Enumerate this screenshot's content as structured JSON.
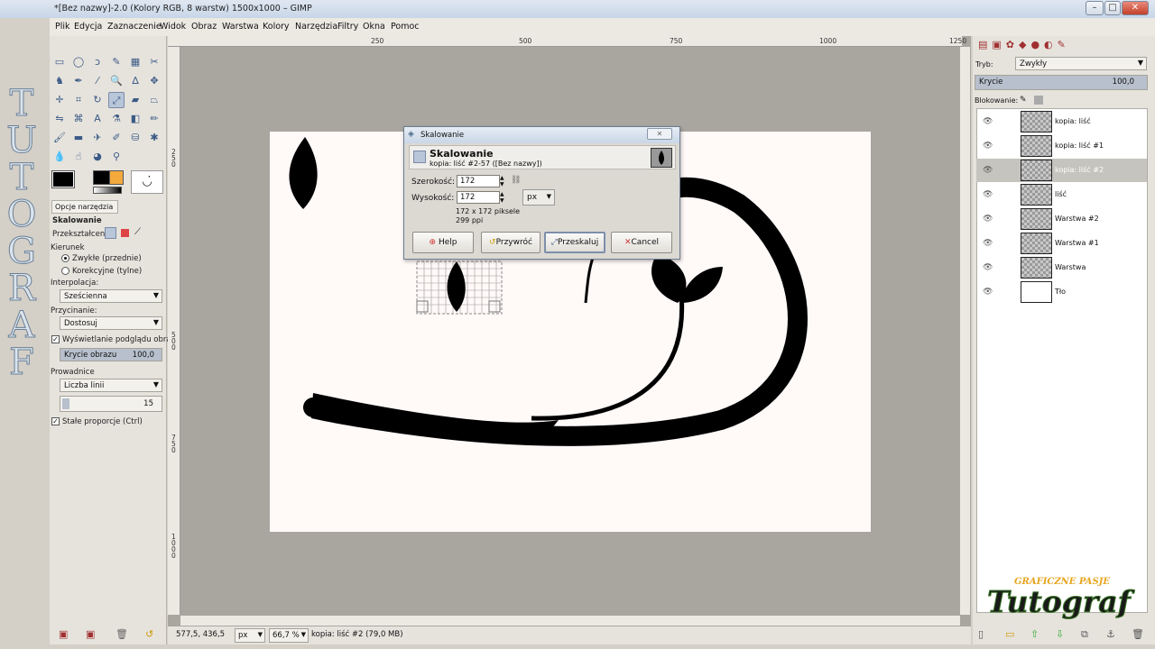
{
  "window": {
    "title": "*[Bez nazwy]-2.0 (Kolory RGB, 8 warstw) 1500x1000 – GIMP",
    "min": "–",
    "max": "□",
    "close": "✕"
  },
  "menu": [
    "Plik",
    "Edycja",
    "Zaznaczenie",
    "Widok",
    "Obraz",
    "Warstwa",
    "Kolory",
    "Narzędzia",
    "Filtry",
    "Okna",
    "Pomoc"
  ],
  "watermark_left": [
    "T",
    "U",
    "T",
    "O",
    "G",
    "R",
    "A",
    "F"
  ],
  "tool_options": {
    "tab_label": "Opcje narzędzia",
    "tool_name": "Skalowanie",
    "transform_label": "Przekształcenie:",
    "direction_label": "Kierunek",
    "direction_options": [
      "Zwykłe (przednie)",
      "Korekcyjne (tylne)"
    ],
    "interpolation_label": "Interpolacja:",
    "interpolation_value": "Sześcienna",
    "clipping_label": "Przycinanie:",
    "clipping_value": "Dostosuj",
    "preview_label": "Wyświetlanie podglądu obrazu",
    "opacity_label": "Krycie obrazu",
    "opacity_value": "100,0",
    "guides_label": "Prowadnice",
    "guides_value": "Liczba linii",
    "lines_value": "15",
    "constrain_label": "Stałe proporcje  (Ctrl)"
  },
  "ruler_top": [
    "250",
    "500",
    "750",
    "1000",
    "1250"
  ],
  "ruler_left": [
    "2\n5\n0",
    "5\n0\n0",
    "7\n5\n0",
    "1\n0\n0\n0"
  ],
  "status": {
    "coords": "577,5, 436,5",
    "unit": "px",
    "zoom": "66,7 %",
    "message": "kopia: liść #2 (79,0 MB)"
  },
  "dialog": {
    "title": "Skalowanie",
    "header_title": "Skalowanie",
    "header_sub": "kopia: liść #2-57 ([Bez nazwy])",
    "width_label": "Szerokość:",
    "width_value": "172",
    "height_label": "Wysokość:",
    "height_value": "172",
    "unit": "px",
    "info_size": "172 x 172 piksele",
    "info_res": "299 ppi",
    "btn_help": "Help",
    "btn_reset": "Przywróć",
    "btn_scale": "Przeskaluj",
    "btn_cancel": "Cancel"
  },
  "layers_panel": {
    "mode_label": "Tryb:",
    "mode_value": "Zwykły",
    "opacity_label": "Krycie",
    "opacity_value": "100,0",
    "lock_label": "Blokowanie:",
    "layers": [
      {
        "name": "kopia: liść",
        "selected": false
      },
      {
        "name": "kopia: liść #1",
        "selected": false
      },
      {
        "name": "kopia: liść #2",
        "selected": true
      },
      {
        "name": "liść",
        "selected": false
      },
      {
        "name": "Warstwa #2",
        "selected": false
      },
      {
        "name": "Warstwa #1",
        "selected": false
      },
      {
        "name": "Warstwa",
        "selected": false
      },
      {
        "name": "Tło",
        "selected": false
      }
    ]
  },
  "logo": {
    "tagline": "GRAFICZNE PASJE",
    "name": "Tutograf"
  },
  "colors": {
    "accent": "#3b5a86",
    "selection": "#c6c4bf",
    "canvas_bg": "#a9a6a0"
  }
}
